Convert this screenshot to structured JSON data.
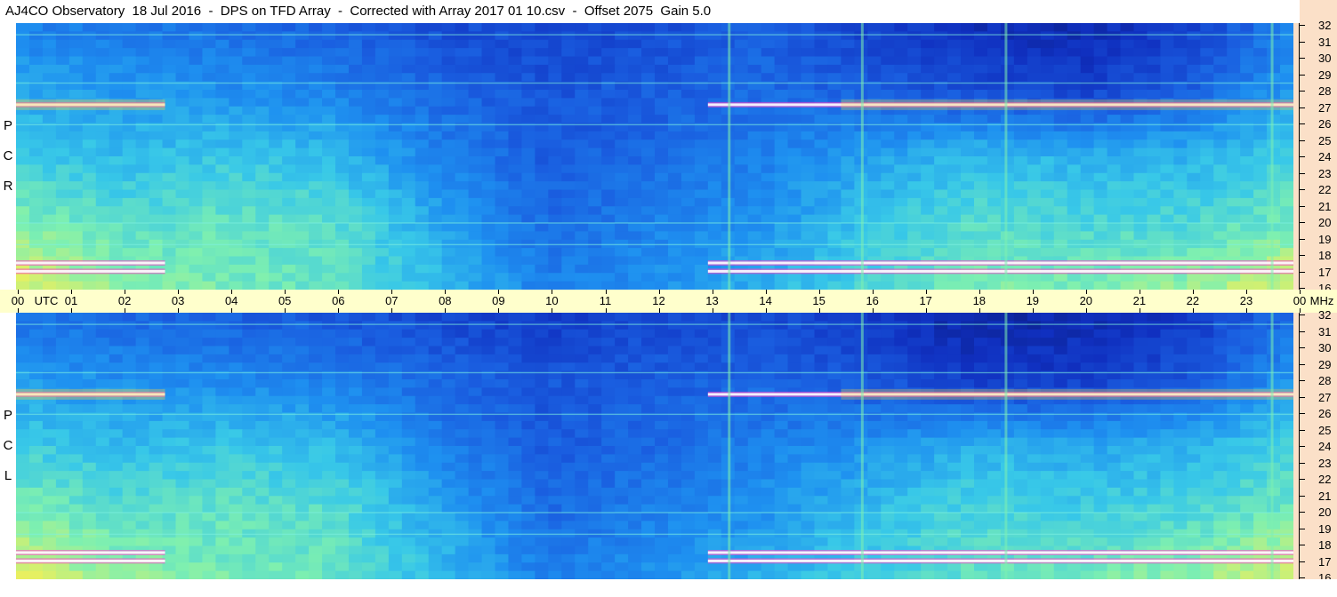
{
  "header": {
    "title": "AJ4CO Observatory  18 Jul 2016  -  DPS on TFD Array  -  Corrected with Array 2017 01 10.csv  -  Offset 2075  Gain 5.0"
  },
  "panels": {
    "top": {
      "polarization_letters": [
        "P",
        "C",
        "R"
      ]
    },
    "bottom": {
      "polarization_letters": [
        "P",
        "C",
        "L"
      ]
    }
  },
  "time_axis": {
    "start_label": "00",
    "utc_label": "UTC",
    "end_label": "00",
    "unit_label": "MHz",
    "hour_labels": [
      "01",
      "02",
      "03",
      "04",
      "05",
      "06",
      "07",
      "08",
      "09",
      "10",
      "11",
      "12",
      "13",
      "14",
      "15",
      "16",
      "17",
      "18",
      "19",
      "20",
      "21",
      "22",
      "23"
    ]
  },
  "freq_axis": {
    "labels": [
      "32",
      "31",
      "30",
      "29",
      "28",
      "27",
      "26",
      "25",
      "24",
      "23",
      "22",
      "21",
      "20",
      "19",
      "18",
      "17",
      "16"
    ]
  },
  "colors": {
    "colormap": [
      "#0a1a78",
      "#1030c0",
      "#1a5ee0",
      "#1e90f0",
      "#38c8e8",
      "#7ef0b0",
      "#e8f060",
      "#ff8040",
      "#ff30c0",
      "#ffffff"
    ],
    "axis_background_right": "#fbe0c8",
    "axis_background_time": "#ffffcc"
  },
  "chart_data": [
    {
      "type": "heatmap",
      "title": "R C P",
      "x_range_utc_hours": [
        0,
        24
      ],
      "y_range_mhz": [
        16,
        32
      ],
      "bright_bands_mhz": [
        27.1,
        17.6,
        17.1
      ],
      "persistent_narrowband_mhz": [
        31.3,
        28.4,
        25.9,
        20.0,
        18.7
      ],
      "vertical_streaks_utc": [
        13.4,
        15.9,
        18.6,
        23.6
      ],
      "relative_levels": {
        "hours": [
          0,
          2,
          4,
          6,
          8,
          10,
          12,
          14,
          16,
          18,
          20,
          22,
          24
        ],
        "freq_mhz": [
          32,
          28,
          24,
          20,
          16
        ],
        "values": [
          [
            0.3,
            0.28,
            0.26,
            0.22,
            0.18,
            0.16,
            0.18,
            0.22,
            0.15,
            0.1,
            0.08,
            0.14,
            0.3
          ],
          [
            0.38,
            0.35,
            0.33,
            0.3,
            0.24,
            0.2,
            0.22,
            0.25,
            0.22,
            0.18,
            0.15,
            0.22,
            0.36
          ],
          [
            0.46,
            0.42,
            0.44,
            0.42,
            0.3,
            0.22,
            0.25,
            0.3,
            0.36,
            0.42,
            0.4,
            0.4,
            0.46
          ],
          [
            0.56,
            0.5,
            0.52,
            0.5,
            0.38,
            0.25,
            0.3,
            0.34,
            0.44,
            0.5,
            0.48,
            0.48,
            0.54
          ],
          [
            0.66,
            0.58,
            0.54,
            0.52,
            0.42,
            0.3,
            0.34,
            0.4,
            0.48,
            0.55,
            0.55,
            0.58,
            0.66
          ]
        ]
      }
    },
    {
      "type": "heatmap",
      "title": "L C P",
      "x_range_utc_hours": [
        0,
        24
      ],
      "y_range_mhz": [
        16,
        32
      ],
      "bright_bands_mhz": [
        27.1,
        17.6,
        17.1
      ],
      "persistent_narrowband_mhz": [
        31.3,
        28.4,
        25.9,
        20.0,
        18.7
      ],
      "vertical_streaks_utc": [
        13.4,
        15.9,
        18.6,
        23.6
      ],
      "relative_levels": {
        "hours": [
          0,
          2,
          4,
          6,
          8,
          10,
          12,
          14,
          16,
          18,
          20,
          22,
          24
        ],
        "freq_mhz": [
          32,
          28,
          24,
          20,
          16
        ],
        "values": [
          [
            0.26,
            0.24,
            0.22,
            0.2,
            0.16,
            0.14,
            0.16,
            0.18,
            0.12,
            0.06,
            0.08,
            0.12,
            0.26
          ],
          [
            0.36,
            0.33,
            0.32,
            0.3,
            0.24,
            0.2,
            0.22,
            0.24,
            0.2,
            0.14,
            0.14,
            0.2,
            0.34
          ],
          [
            0.46,
            0.42,
            0.44,
            0.42,
            0.3,
            0.22,
            0.25,
            0.3,
            0.34,
            0.4,
            0.38,
            0.4,
            0.46
          ],
          [
            0.56,
            0.5,
            0.52,
            0.5,
            0.38,
            0.25,
            0.3,
            0.34,
            0.42,
            0.48,
            0.46,
            0.48,
            0.54
          ],
          [
            0.66,
            0.58,
            0.54,
            0.52,
            0.42,
            0.3,
            0.34,
            0.4,
            0.46,
            0.52,
            0.54,
            0.58,
            0.66
          ]
        ]
      }
    }
  ]
}
